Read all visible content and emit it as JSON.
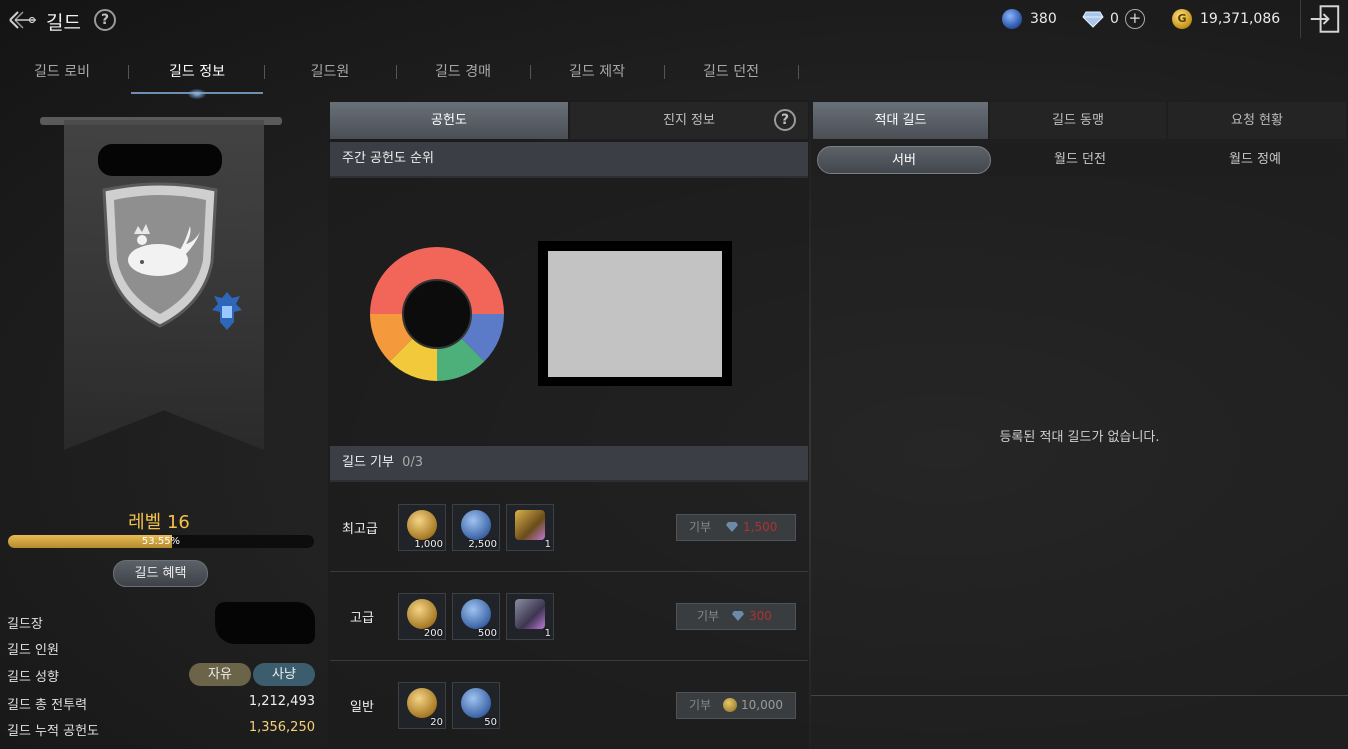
{
  "header": {
    "title": "길드",
    "currency_blue": "380",
    "currency_diamond": "0",
    "currency_gold": "19,371,086"
  },
  "tabs": [
    {
      "label": "길드 로비"
    },
    {
      "label": "길드 정보"
    },
    {
      "label": "길드원"
    },
    {
      "label": "길드 경매"
    },
    {
      "label": "길드 제작"
    },
    {
      "label": "길드 던전"
    }
  ],
  "guild": {
    "level_label": "레벨 16",
    "xp_percent_text": "53.55%",
    "xp_fraction": 0.5355,
    "benefit_button": "길드 혜택",
    "rows": {
      "leader_label": "길드장",
      "members_label": "길드 인원",
      "tendency_label": "길드 성향",
      "tendency_tag1": "자유",
      "tendency_tag2": "사냥",
      "power_label": "길드 총 전투력",
      "power_value": "1,212,493",
      "contribution_label": "길드 누적 공헌도",
      "contribution_value": "1,356,250"
    }
  },
  "middle": {
    "tab_contribution": "공헌도",
    "tab_camp": "진지 정보",
    "weekly_heading": "주간 공헌도 순위",
    "donation_heading": "길드 기부",
    "donation_count": "0/3",
    "tiers": [
      {
        "label": "최고급",
        "items": [
          "1,000",
          "2,500",
          "1"
        ],
        "button": "기부",
        "cost": "1,500"
      },
      {
        "label": "고급",
        "items": [
          "200",
          "500",
          "1"
        ],
        "button": "기부",
        "cost": "300"
      },
      {
        "label": "일반",
        "items": [
          "20",
          "50"
        ],
        "button": "기부",
        "cost": "10,000"
      }
    ]
  },
  "right": {
    "tab_hostile": "적대 길드",
    "tab_alliance": "길드 동맹",
    "tab_requests": "요청 현황",
    "seg_server": "서버",
    "seg_world_dungeon": "월드 던전",
    "seg_world_conquest": "월드 정예",
    "empty_message": "등록된 적대 길드가 없습니다."
  },
  "colors": {
    "accent_gold": "#f3c24a",
    "tag_free": "#6b6448",
    "tag_hunt": "#3b5d6e",
    "donut": [
      "#5b7bc8",
      "#4db07a",
      "#f2c93a",
      "#f59a3c",
      "#f2665a"
    ]
  }
}
